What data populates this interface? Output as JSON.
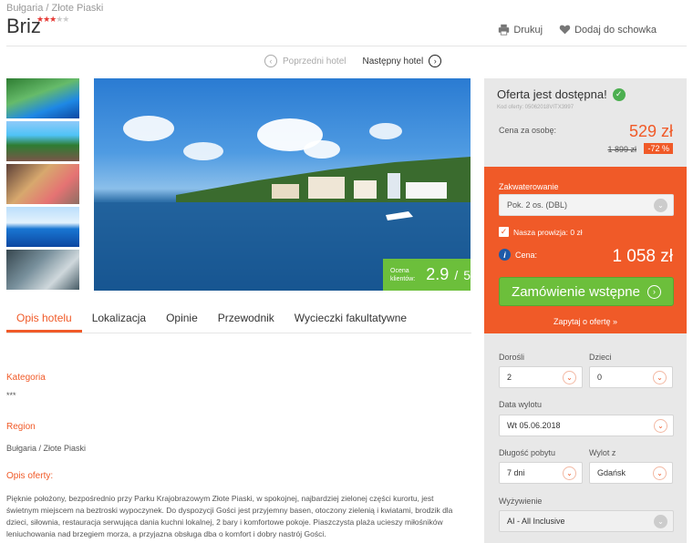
{
  "breadcrumb": "Bułgaria / Złote Piaski",
  "hotel": {
    "name": "Briz",
    "stars_on": "★★★",
    "stars_off": "★★"
  },
  "actions": {
    "print": "Drukuj",
    "favorite": "Dodaj do schowka"
  },
  "hotel_nav": {
    "prev": "Poprzedni hotel",
    "next": "Następny hotel"
  },
  "rating": {
    "label": "Ocena klientów:",
    "value": "2.9",
    "denominator": "5"
  },
  "tabs": [
    "Opis hotelu",
    "Lokalizacja",
    "Opinie",
    "Przewodnik",
    "Wycieczki fakultatywne"
  ],
  "details": {
    "category_label": "Kategoria",
    "category_value": "***",
    "region_label": "Region",
    "region_value": "Bułgaria / Złote Piaski",
    "offer_label": "Opis oferty:",
    "description": "Pięknie położony, bezpośrednio przy Parku Krajobrazowym Złote Piaski, w spokojnej, najbardziej zielonej części kurortu, jest świetnym miejscem na beztroski wypoczynek. Do dyspozycji Gości jest przyjemny basen, otoczony zielenią i kwiatami, brodzik dla dzieci, siłownia, restauracja serwująca dania kuchni lokalnej, 2 bary i komfortowe pokoje. Piaszczysta plaża ucieszy miłośników leniuchowania nad brzegiem morza, a przyjazna obsługa dba o komfort i dobry nastrój Gości."
  },
  "offer": {
    "title": "Oferta jest dostępna!",
    "code": "Kod oferty: 05062018VITX3997",
    "price_label": "Cena za osobę:",
    "price": "529 zł",
    "old_price": "1 899 zł",
    "discount": "-72 %",
    "accommodation_label": "Zakwaterowanie",
    "accommodation_value": "Pok. 2 os. (DBL)",
    "commission": "Nasza prowizja: 0 zł",
    "total_label": "Cena:",
    "total": "1 058 zł",
    "order_button": "Zamówienie wstępne",
    "ask_link": "Zapytaj o ofertę »"
  },
  "form": {
    "adults_label": "Dorośli",
    "adults_value": "2",
    "children_label": "Dzieci",
    "children_value": "0",
    "departure_label": "Data wylotu",
    "departure_value": "Wt 05.06.2018",
    "duration_label": "Długość pobytu",
    "duration_value": "7 dni",
    "from_label": "Wylot z",
    "from_value": "Gdańsk",
    "board_label": "Wyżywienie",
    "board_value": "AI - All Inclusive"
  }
}
